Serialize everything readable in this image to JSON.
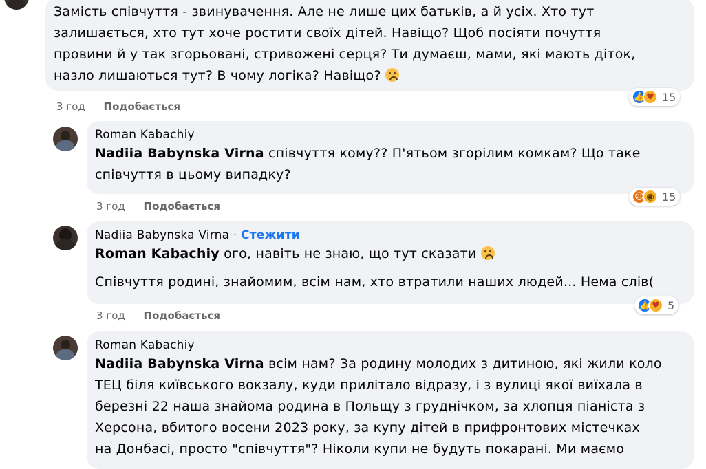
{
  "comments": [
    {
      "author": "",
      "mention": "",
      "lines": [
        "Замість співчуття - звинувачення. Але не лише цих батьків, а й усіх. Хто тут",
        "залишається, хто тут хоче ростити своїх дітей. Навіщо? Щоб посіяти почуття",
        "провини й у так згорьовані, стривожені серця? Ти думаєш, мами, які мають діток,",
        "назло лишаються тут? В чому логіка? Навіщо?"
      ],
      "time": "3 год",
      "like_label": "Подобається",
      "reaction_icons": [
        "like-icon",
        "care-icon"
      ],
      "reaction_count": "15"
    },
    {
      "author": "Roman Kabachiy",
      "mention": "Nadiia Babynska Virna",
      "first_line_rest": " співчуття кому?? П'ятьом згорілим комкам? Що таке",
      "lines": [
        "співчуття в цьому випадку?"
      ],
      "time": "3 год",
      "like_label": "Подобається",
      "reaction_icons": [
        "angry-icon",
        "wow-icon"
      ],
      "reaction_count": "15"
    },
    {
      "author": "Nadiia Babynska Virna",
      "separator": "·",
      "follow_label": "Стежити",
      "mention": "Roman Kabachiy",
      "first_line_rest": " ого, навіть не знаю, що тут сказати",
      "lines": [
        "Співчуття родині, знайомим, всім нам, хто втратили наших людей... Нема слів("
      ],
      "time": "3 год",
      "like_label": "Подобається",
      "reaction_icons": [
        "like-icon",
        "care-icon"
      ],
      "reaction_count": "5"
    },
    {
      "author": "Roman Kabachiy",
      "mention": "Nadiia Babynska Virna",
      "first_line_rest": " всім нам? За родину молодих з дитиною, які жили коло",
      "lines": [
        "ТЕЦ біля київського вокзалу, куди прилітало відразу, і з вулиці якої виїхала в",
        "березні 22 наша знайома родина в Польщу з груднічком, за хлопця піаніста з",
        "Херсона, вбитого восени 2023 року, за купу дітей в прифронтових містечках",
        "на Донбасі, просто \"співчуття\"? Ніколи купи не будуть покарані. Ми маємо"
      ]
    }
  ],
  "colors": {
    "bubble_bg": "#f0f2f5",
    "follow_blue": "#1877f2",
    "meta_gray": "#65676b"
  }
}
